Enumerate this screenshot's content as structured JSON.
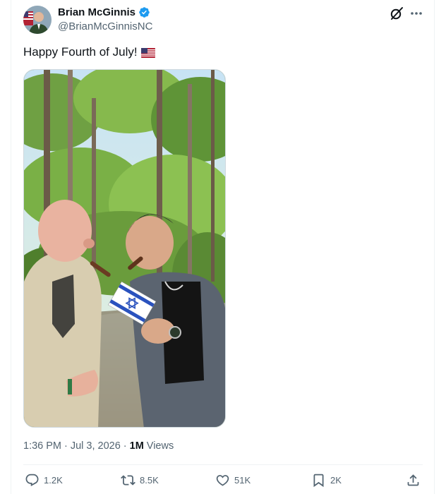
{
  "author": {
    "display_name": "Brian McGinnis",
    "handle": "@BrianMcGinnisNC",
    "verified": true
  },
  "tweet": {
    "text": "Happy Fourth of July!",
    "emoji_icon": "us-flag-icon"
  },
  "meta": {
    "time": "1:36 PM",
    "date": "Jul 3, 2026",
    "views_count": "1M",
    "views_label": "Views"
  },
  "actions": {
    "replies": "1.2K",
    "reposts": "8.5K",
    "likes": "51K",
    "bookmarks": "2K"
  },
  "colors": {
    "verified_blue": "#1d9bf0",
    "secondary_text": "#536471",
    "primary_text": "#0f1419"
  }
}
